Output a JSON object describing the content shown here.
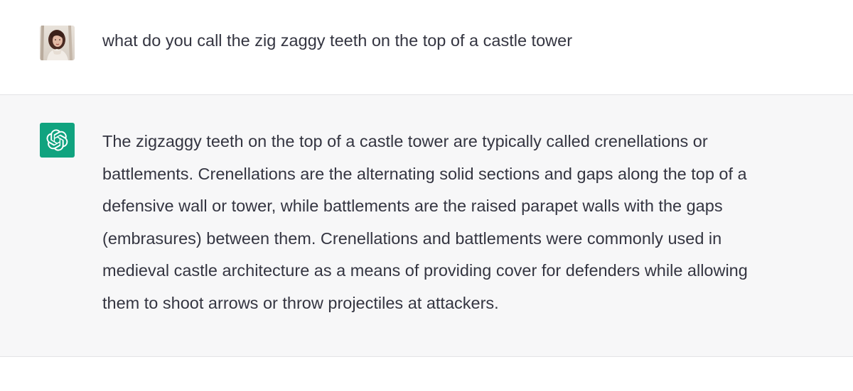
{
  "conversation": {
    "user_message": {
      "avatar_icon": "user-photo-avatar",
      "text": "what do you call the zig zaggy teeth on the top of a castle tower"
    },
    "assistant_message": {
      "avatar_icon": "openai-logo-icon",
      "avatar_color": "#10a37f",
      "lines": [
        "The zigzaggy teeth on the top of a castle tower are typically called crenellations or",
        "battlements. Crenellations are the alternating solid sections and gaps along the top of a",
        "defensive wall or tower, while battlements are the raised parapet walls with the gaps",
        "(embrasures) between them. Crenellations and battlements were commonly used in",
        "medieval castle architecture as a means of providing cover for defenders while allowing",
        "them to shoot arrows or throw projectiles at attackers."
      ]
    }
  },
  "colors": {
    "user_bg": "#ffffff",
    "assistant_bg": "#f7f7f8",
    "text": "#343541",
    "divider": "#e3e3e6"
  }
}
